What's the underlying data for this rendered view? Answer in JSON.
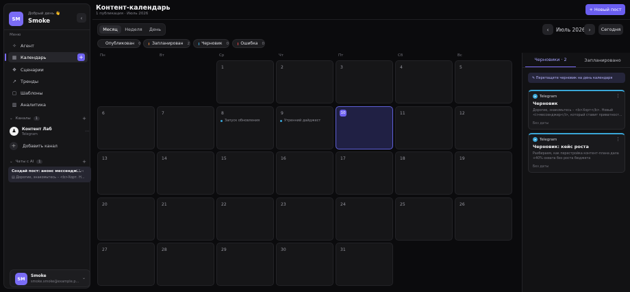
{
  "sidebar": {
    "avatar": "SM",
    "greeting": "Добрый день 👋",
    "username": "Smoke",
    "collapse_icon": "‹",
    "menu_label": "Меню",
    "items": [
      {
        "label": "Агент",
        "icon": "✧"
      },
      {
        "label": "Календарь",
        "icon": "▦"
      },
      {
        "label": "Сценарии",
        "icon": "❖"
      },
      {
        "label": "Тренды",
        "icon": "↗"
      },
      {
        "label": "Шаблоны",
        "icon": "▢"
      },
      {
        "label": "Аналитика",
        "icon": "▥"
      }
    ],
    "calendar_add": "+",
    "channels_label": "Каналы",
    "channels_count": "1",
    "channel": {
      "icon": "♟",
      "name": "Контент Лаб",
      "sub": "Telegram",
      "more": "⋯"
    },
    "add_channel": "Добавить канал",
    "chats_label": "Чаты с AI",
    "chats_count": "1",
    "chat": {
      "title": "Создай пост: анонс мессендж...",
      "snippet": "▤ Дорогие, знакомьтесь – <b>Хорт. Н...",
      "meta": "13 ч"
    },
    "user": {
      "avatar": "SM",
      "name": "Smoke",
      "email": "smoke.smoke@example.p..."
    }
  },
  "header": {
    "title": "Контент-календарь",
    "subtitle": "1 публикация · Июль 2026",
    "new_post": "+ Новый пост"
  },
  "views": [
    "Месяц",
    "Неделя",
    "День"
  ],
  "active_view": "Месяц",
  "month_nav": {
    "prev": "‹",
    "label": "Июль 2026",
    "next": "›",
    "today": "Сегодня"
  },
  "filters": [
    {
      "label": "Опубликован",
      "count": "0",
      "color": "#3ecf8e"
    },
    {
      "label": "Запланирован",
      "count": "2",
      "color": "#f08c3a"
    },
    {
      "label": "Черновик",
      "count": "0",
      "color": "#3aa7d8"
    },
    {
      "label": "Ошибка",
      "count": "0",
      "color": "#e5484d"
    }
  ],
  "weekdays": [
    "Пн",
    "Вт",
    "Ср",
    "Чт",
    "Пт",
    "Сб",
    "Вс"
  ],
  "calendar": {
    "today": "10",
    "events": {
      "8": "Запуск обновления",
      "9": "Утренний дайджест"
    }
  },
  "panel": {
    "tabs": [
      "Черновики · 2",
      "Запланировано"
    ],
    "hint": "✎ Перетащите черновик на день календаря",
    "drafts": [
      {
        "network": "Telegram",
        "title": "Черновик",
        "text": "Дорогие, знакомьтесь – <b>Хорт</b>. Новый <i>мессенджер</i>, который ставит приватност...",
        "date": "Без даты"
      },
      {
        "network": "Telegram",
        "title": "Черновик: кейс роста",
        "text": "Разбираем, как перестройка контент-плана дала +40% охвата без роста бюджета",
        "date": "Без даты"
      }
    ]
  }
}
